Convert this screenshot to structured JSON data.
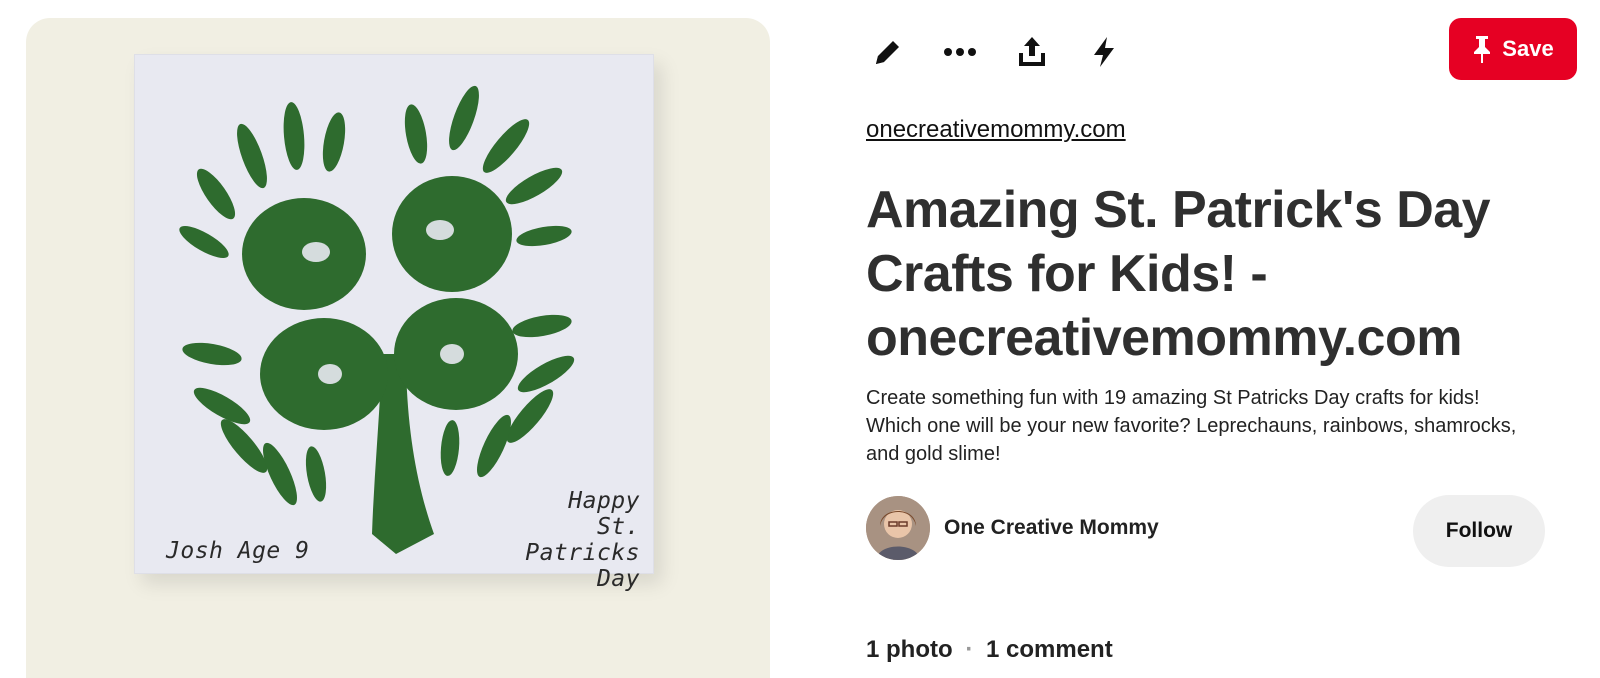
{
  "pin_image": {
    "handwriting": {
      "name": "Josh  Age 9",
      "greeting": [
        "Happy",
        "St. Patricks",
        "Day"
      ]
    }
  },
  "toolbar": {
    "icons": [
      "pencil-icon",
      "more-icon",
      "share-icon",
      "lightning-icon"
    ],
    "save_label": "Save"
  },
  "pin": {
    "source": "onecreativemommy.com",
    "title": "Amazing St. Patrick's Day Crafts for Kids! - onecreativemommy.com",
    "description": "Create something fun with 19 amazing St Patricks Day crafts for kids! Which one will be your new favorite? Leprechauns, rainbows, shamrocks, and gold slime!"
  },
  "creator": {
    "name": "One Creative Mommy",
    "follow_label": "Follow"
  },
  "stats": {
    "photos": "1 photo",
    "comments": "1 comment"
  },
  "colors": {
    "save_red": "#e60023",
    "shamrock_green": "#2e6b2e",
    "follow_bg": "#efefef"
  }
}
